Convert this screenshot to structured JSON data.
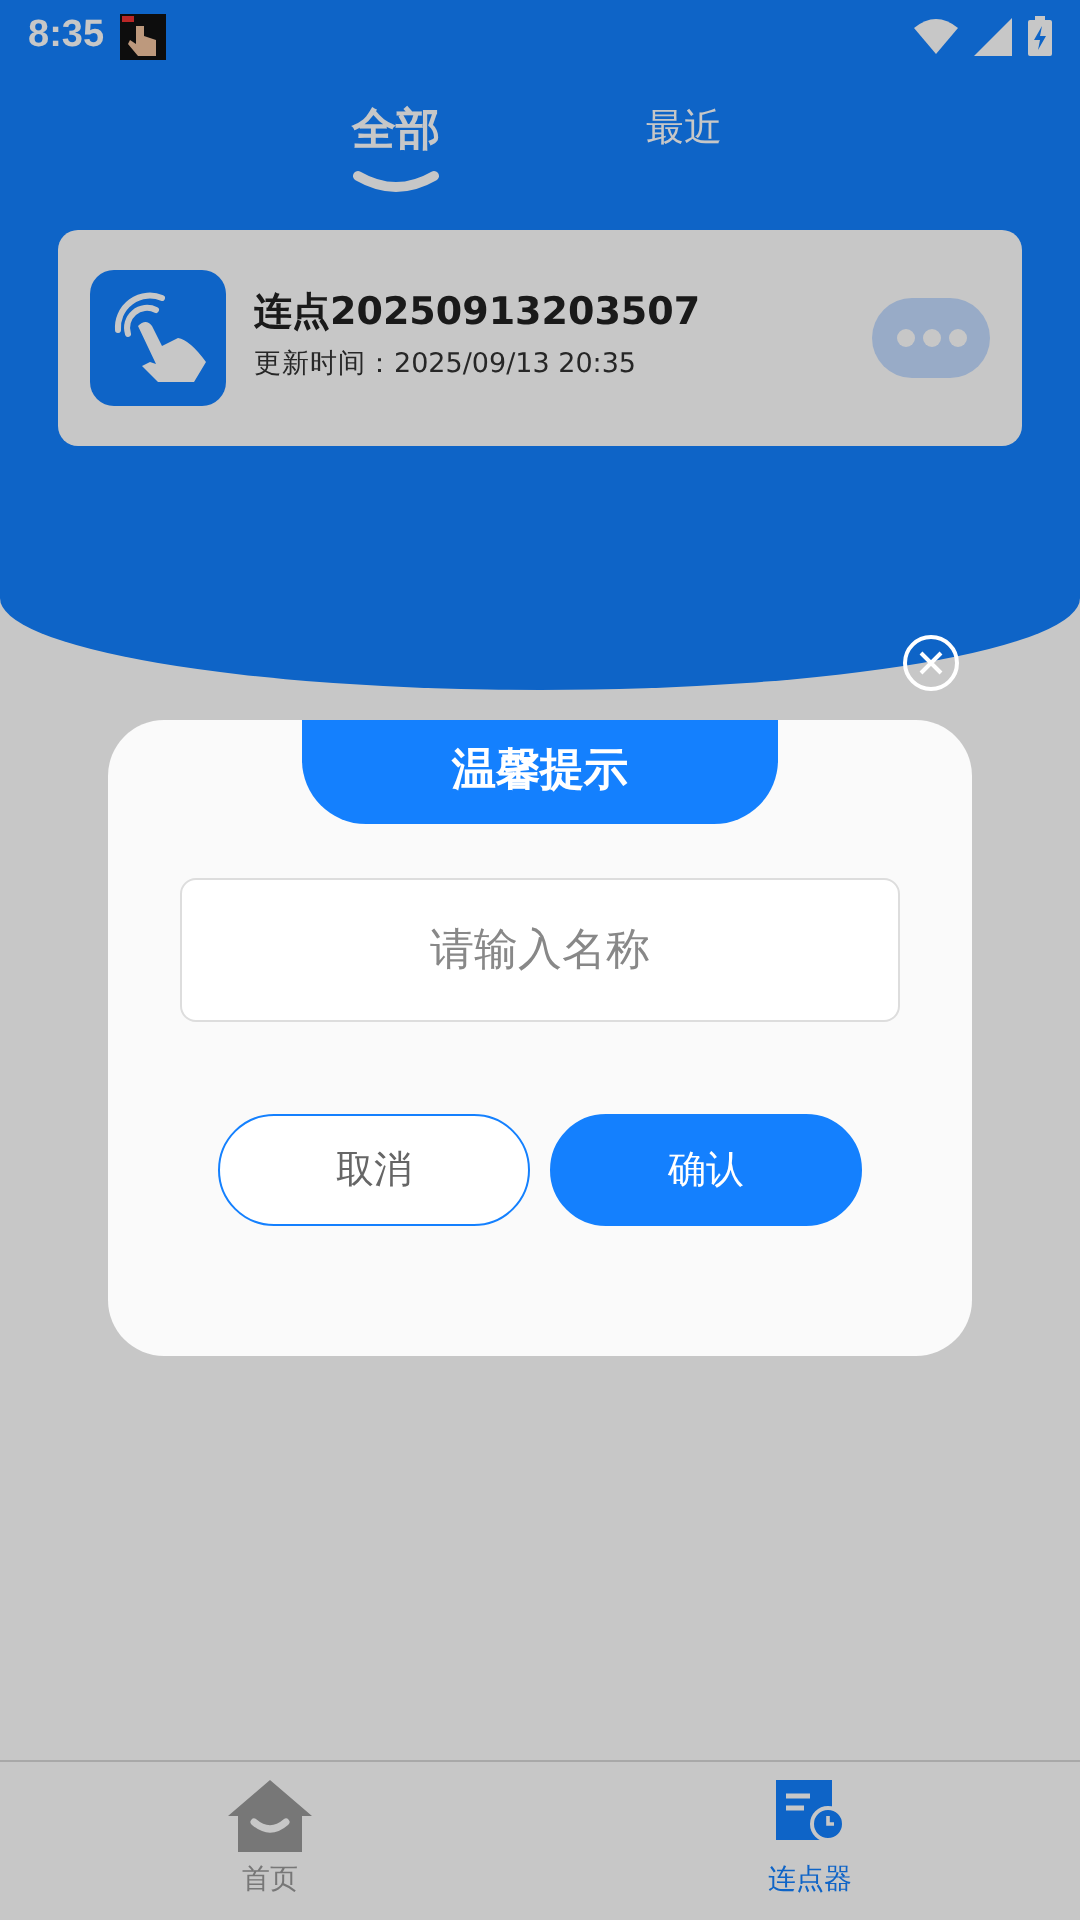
{
  "status_bar": {
    "time": "8:35"
  },
  "tabs": [
    {
      "label": "全部",
      "selected": true
    },
    {
      "label": "最近",
      "selected": false
    }
  ],
  "items": [
    {
      "title": "连点20250913203507",
      "updated": "更新时间：2025/09/13 20:35"
    }
  ],
  "dialog": {
    "title": "温馨提示",
    "input": {
      "placeholder": "请输入名称"
    },
    "buttons": [
      {
        "label": "取消",
        "kind": "secondary"
      },
      {
        "label": "确认",
        "kind": "primary"
      }
    ]
  },
  "bottom_nav": [
    {
      "label": "首页",
      "selected": false
    },
    {
      "label": "连点器",
      "selected": true
    }
  ]
}
